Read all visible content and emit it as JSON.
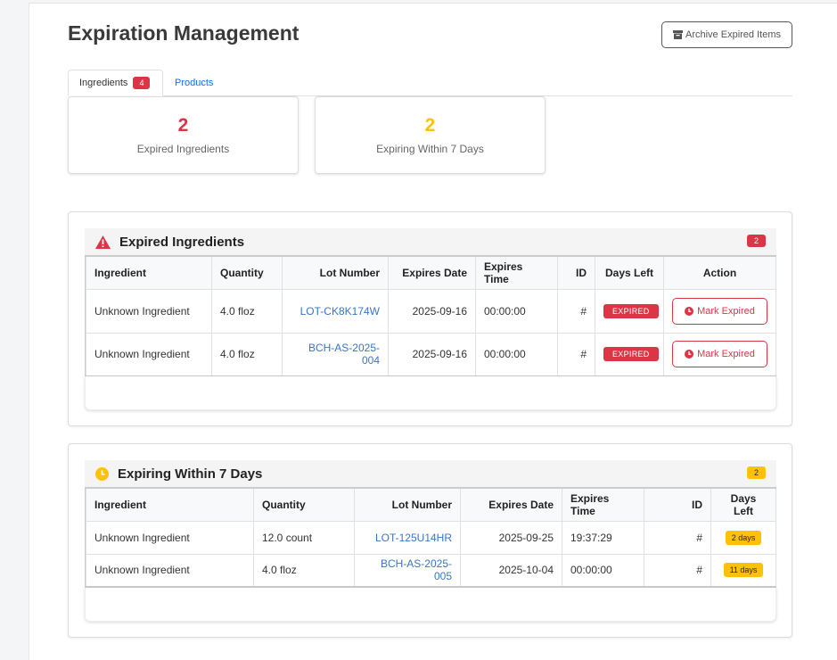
{
  "page": {
    "title": "Expiration Management"
  },
  "toolbar": {
    "archive_label": "Archive Expired Items"
  },
  "tabs": [
    {
      "label": "Ingredients",
      "badge": "4",
      "active": true
    },
    {
      "label": "Products",
      "active": false
    }
  ],
  "stats": [
    {
      "value": "2",
      "label": "Expired Ingredients",
      "color": "#dc3545"
    },
    {
      "value": "2",
      "label": "Expiring Within 7 Days",
      "color": "#ffc107"
    }
  ],
  "expired": {
    "title": "Expired Ingredients",
    "count": "2",
    "columns": [
      "Ingredient",
      "Quantity",
      "Lot Number",
      "Expires Date",
      "Expires Time",
      "ID",
      "Days Left",
      "Action"
    ],
    "rows": [
      {
        "ingredient": "Unknown Ingredient",
        "quantity": "4.0 floz",
        "lot": "LOT-CK8K174W",
        "date": "2025-09-16",
        "time": "00:00:00",
        "id": "#",
        "days": "EXPIRED",
        "action": "Mark Expired"
      },
      {
        "ingredient": "Unknown Ingredient",
        "quantity": "4.0 floz",
        "lot": "BCH-AS-2025-004",
        "date": "2025-09-16",
        "time": "00:00:00",
        "id": "#",
        "days": "EXPIRED",
        "action": "Mark Expired"
      }
    ]
  },
  "expiring": {
    "title": "Expiring Within 7 Days",
    "count": "2",
    "columns": [
      "Ingredient",
      "Quantity",
      "Lot Number",
      "Expires Date",
      "Expires Time",
      "ID",
      "Days Left"
    ],
    "rows": [
      {
        "ingredient": "Unknown Ingredient",
        "quantity": "12.0 count",
        "lot": "LOT-125U14HR",
        "date": "2025-09-25",
        "time": "19:37:29",
        "id": "#",
        "days": "2 days"
      },
      {
        "ingredient": "Unknown Ingredient",
        "quantity": "4.0 floz",
        "lot": "BCH-AS-2025-005",
        "date": "2025-10-04",
        "time": "00:00:00",
        "id": "#",
        "days": "11 days"
      }
    ]
  },
  "colors": {
    "danger": "#dc3545",
    "warning": "#ffc107",
    "link": "#3a75c4"
  },
  "icons": {
    "archive": "archive-icon",
    "warning": "warning-triangle-icon",
    "clock": "clock-icon"
  }
}
